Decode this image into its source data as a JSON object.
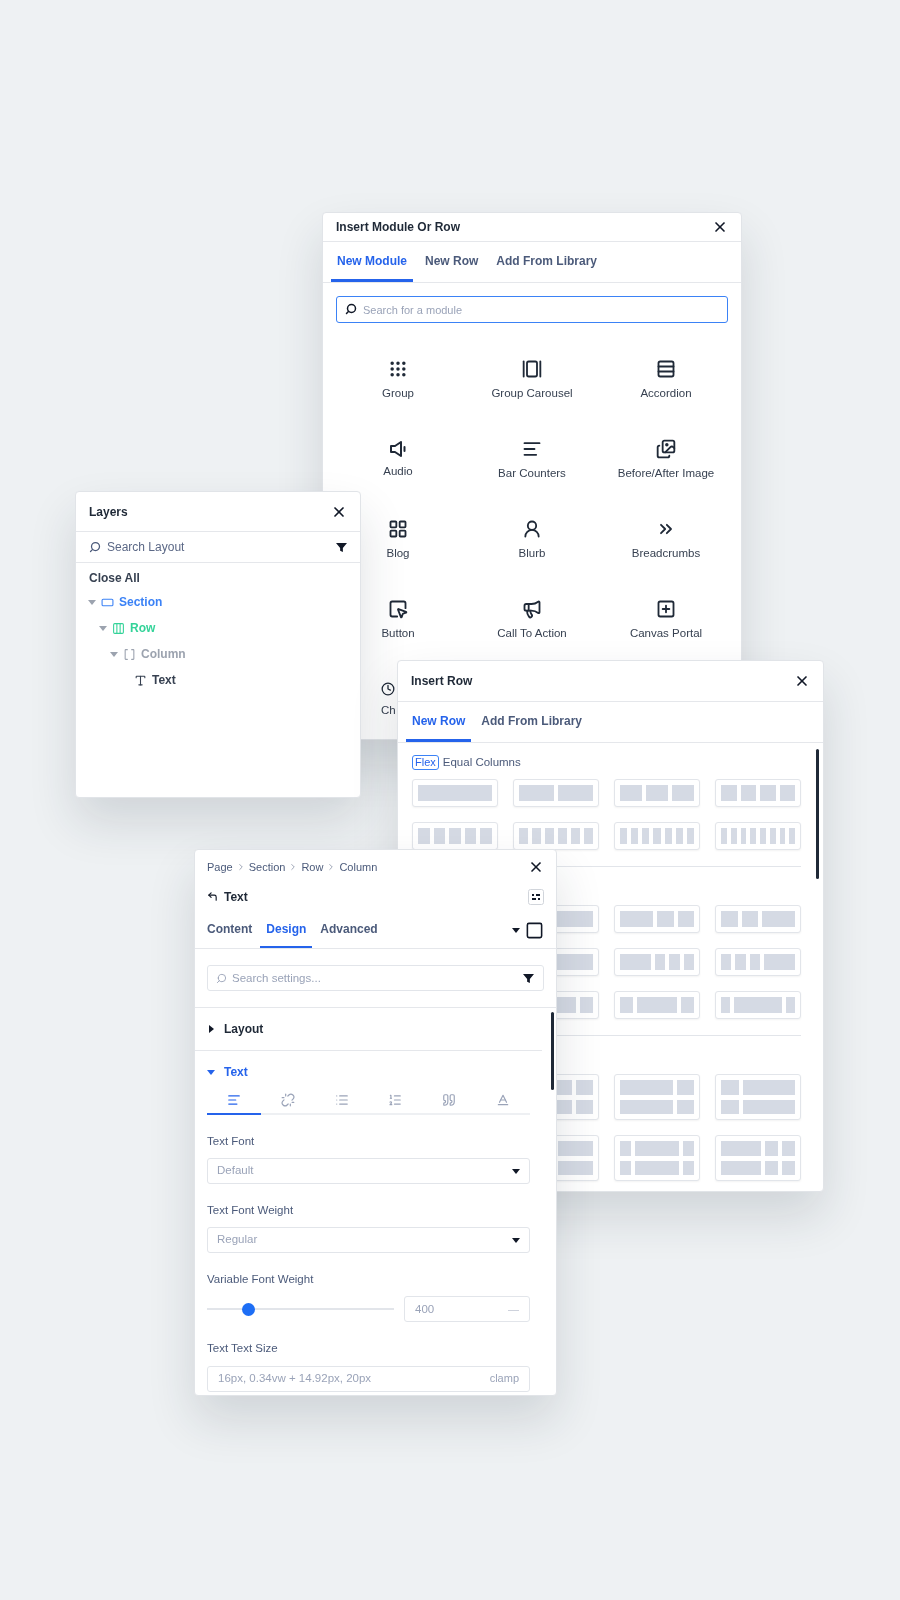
{
  "module_panel": {
    "title": "Insert Module Or Row",
    "tabs": [
      {
        "label": "New Module",
        "selected": true
      },
      {
        "label": "New Row",
        "selected": false
      },
      {
        "label": "Add From Library",
        "selected": false
      }
    ],
    "search": {
      "placeholder": "Search for a module"
    },
    "modules": [
      {
        "label": "Group",
        "kind": "group"
      },
      {
        "label": "Group Carousel",
        "kind": "carousel"
      },
      {
        "label": "Accordion",
        "kind": "accordion"
      },
      {
        "label": "Audio",
        "kind": "audio"
      },
      {
        "label": "Bar Counters",
        "kind": "bars"
      },
      {
        "label": "Before/After Image",
        "kind": "beforeafter"
      },
      {
        "label": "Blog",
        "kind": "blog"
      },
      {
        "label": "Blurb",
        "kind": "blurb"
      },
      {
        "label": "Breadcrumbs",
        "kind": "breadcrumbs"
      },
      {
        "label": "Button",
        "kind": "button"
      },
      {
        "label": "Call To Action",
        "kind": "cta"
      },
      {
        "label": "Canvas Portal",
        "kind": "portal"
      },
      {
        "label": "Ch",
        "kind": "clock"
      }
    ]
  },
  "layers_panel": {
    "title": "Layers",
    "search": {
      "placeholder": "Search Layout"
    },
    "close_all": "Close All",
    "tree": [
      {
        "label": "Section",
        "kind": "section",
        "color": "#3b82f6",
        "expanded": true,
        "children": [
          {
            "label": "Row",
            "kind": "row",
            "color": "#34d399",
            "expanded": true,
            "children": [
              {
                "label": "Column",
                "kind": "column",
                "color": "#9ca3af",
                "expanded": true,
                "children": [
                  {
                    "label": "Text",
                    "kind": "text",
                    "color": "#374151"
                  }
                ]
              }
            ]
          }
        ]
      }
    ]
  },
  "row_panel": {
    "title": "Insert Row",
    "tabs": [
      {
        "label": "New Row",
        "selected": true
      },
      {
        "label": "Add From Library",
        "selected": false
      }
    ],
    "section": {
      "badge": "Flex",
      "heading": "Equal Columns"
    }
  },
  "settings_panel": {
    "breadcrumb": [
      "Page",
      "Section",
      "Row",
      "Column"
    ],
    "element": "Text",
    "tabs": [
      {
        "label": "Content",
        "selected": false
      },
      {
        "label": "Design",
        "selected": true
      },
      {
        "label": "Advanced",
        "selected": false
      }
    ],
    "search": {
      "placeholder": "Search settings..."
    },
    "groups": [
      {
        "label": "Layout",
        "expanded": false
      },
      {
        "label": "Text",
        "expanded": true
      }
    ],
    "text_tabs": [
      {
        "kind": "align",
        "selected": true
      },
      {
        "kind": "link",
        "selected": false
      },
      {
        "kind": "list",
        "selected": false
      },
      {
        "kind": "ordered",
        "selected": false
      },
      {
        "kind": "quote",
        "selected": false
      },
      {
        "kind": "heading",
        "selected": false
      }
    ],
    "fields": [
      {
        "kind": "select",
        "label": "Text Font",
        "value": "Default"
      },
      {
        "kind": "select",
        "label": "Text Font Weight",
        "value": "Regular"
      },
      {
        "kind": "slider",
        "label": "Variable Font Weight",
        "level": 0.2,
        "value": "400",
        "unit": "—"
      },
      {
        "kind": "text",
        "label": "Text Text Size",
        "value": "16px, 0.34vw + 14.92px, 20px",
        "unit": "clamp"
      }
    ]
  }
}
